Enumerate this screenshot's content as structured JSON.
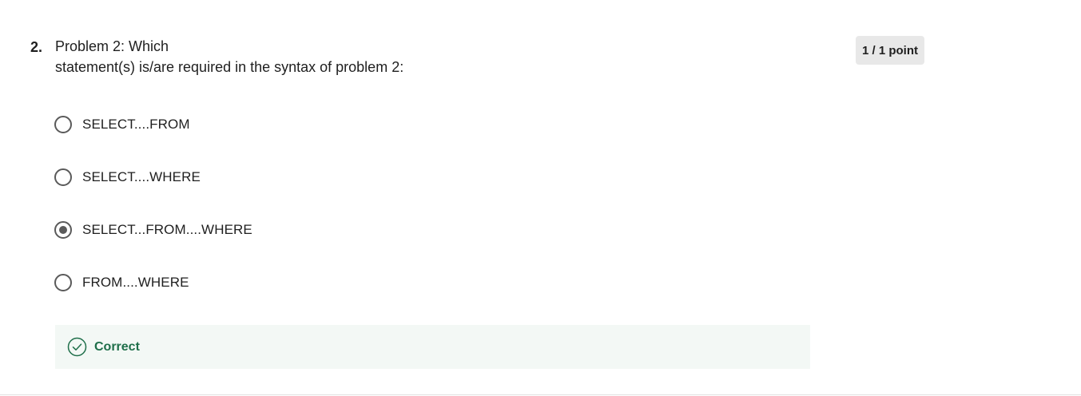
{
  "question": {
    "number": "2.",
    "line1": "Problem 2: Which",
    "line2": "statement(s) is/are required in the syntax of problem 2:"
  },
  "score": {
    "label": "1 / 1 point"
  },
  "options": [
    {
      "label": "SELECT....FROM",
      "selected": false
    },
    {
      "label": "SELECT....WHERE",
      "selected": false
    },
    {
      "label": "SELECT...FROM....WHERE",
      "selected": true
    },
    {
      "label": "FROM....WHERE",
      "selected": false
    }
  ],
  "feedback": {
    "label": "Correct",
    "icon": "check-circle-icon",
    "color": "#1f6f4a"
  },
  "colors": {
    "radio_border": "#5a5a5a",
    "feedback_bg": "#f3f8f5",
    "score_bg": "#e8e8e8"
  }
}
